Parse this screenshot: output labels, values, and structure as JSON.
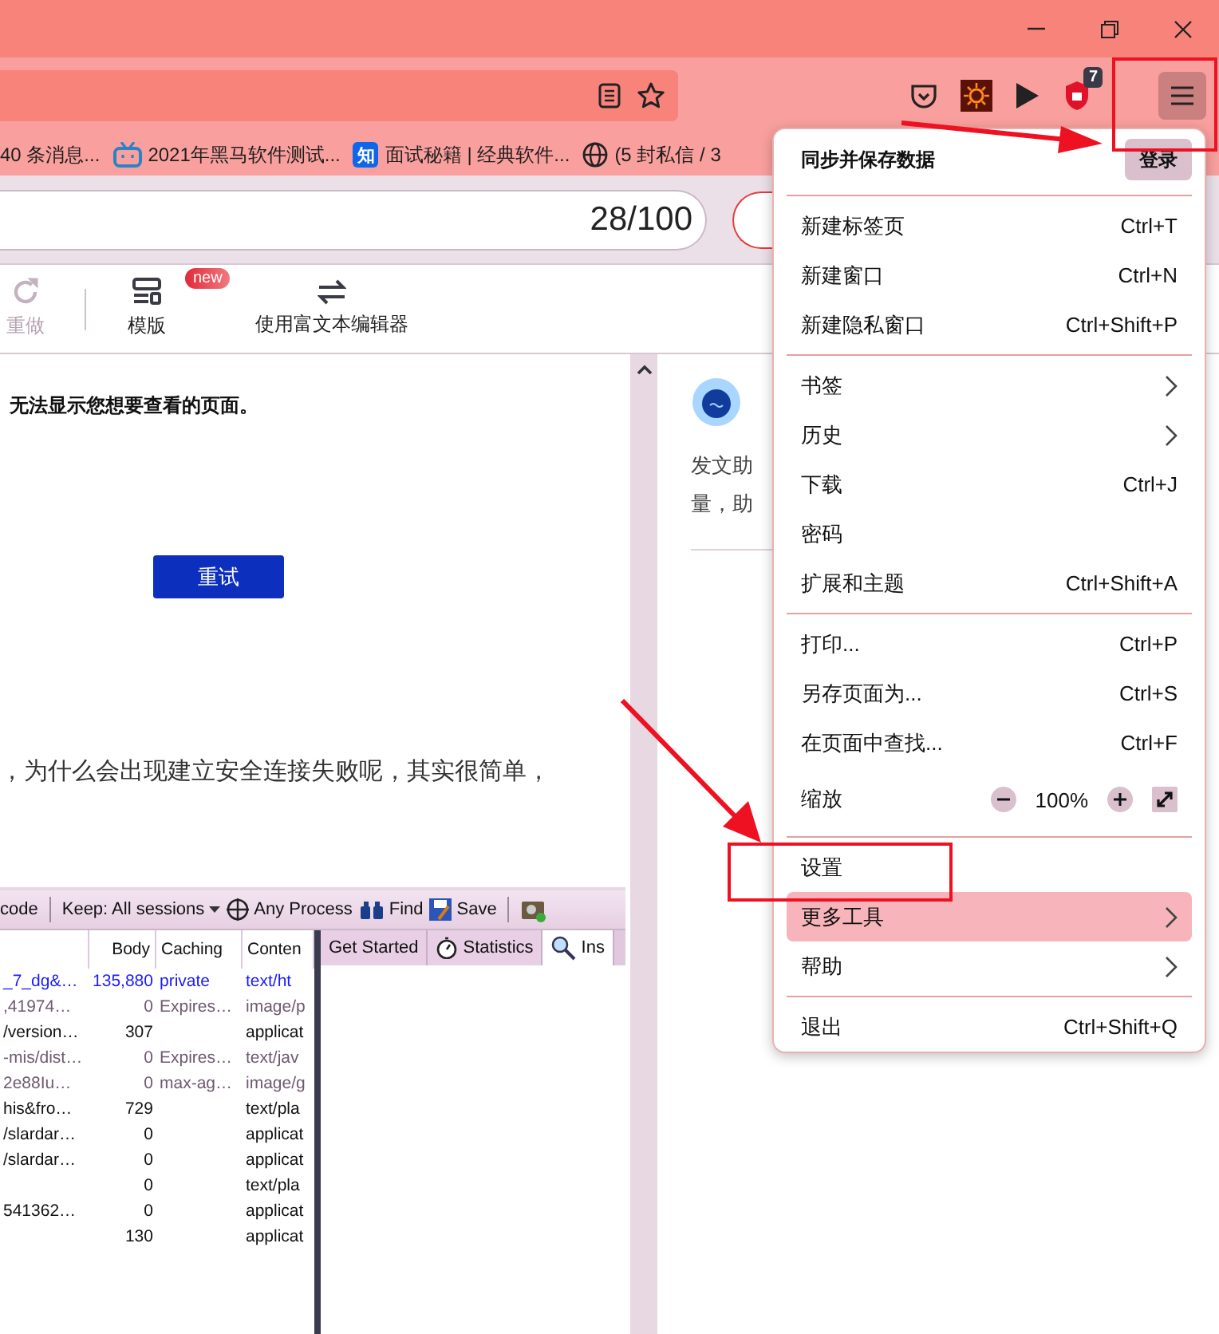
{
  "toolbar": {
    "extension_badge": "7"
  },
  "bookmarks": [
    {
      "label": "40 条消息...",
      "kind": "plain"
    },
    {
      "label": "2021年黑马软件测试...",
      "kind": "video"
    },
    {
      "label": "面试秘籍 | 经典软件...",
      "kind": "lettermark",
      "icon_text": "知"
    },
    {
      "label": "(5 封私信 / 3",
      "kind": "web"
    }
  ],
  "title_field": {
    "counter": "28/100"
  },
  "editor_toolbar": [
    {
      "label": "重做",
      "kind": "redo",
      "disabled": true
    },
    {
      "label": "模版",
      "kind": "template",
      "disabled": false,
      "badge": "new"
    },
    {
      "label": "使用富文本编辑器",
      "kind": "switch",
      "disabled": false
    }
  ],
  "editor": {
    "error_message": "无法显示您想要查看的页面。",
    "retry_button": "重试",
    "paragraph": "，为什么会出现建立安全连接失败呢，其实很简单，"
  },
  "assistant": {
    "text_lines": [
      "发文助",
      "量，助"
    ]
  },
  "fiddler": {
    "toolbar": [
      {
        "label": "code",
        "kind": "text"
      },
      {
        "label": "Keep: All sessions",
        "kind": "dropdown"
      },
      {
        "label": "Any Process",
        "kind": "target"
      },
      {
        "label": "Find",
        "kind": "find"
      },
      {
        "label": "Save",
        "kind": "save"
      }
    ],
    "columns": [
      "Body",
      "Caching",
      "Conten"
    ],
    "rows": [
      {
        "url": "_7_dg&…",
        "body": "135,880",
        "caching": "private",
        "content": "text/ht",
        "color": "#1a1aff"
      },
      {
        "url": ",41974…",
        "body": "0",
        "caching": "Expires…",
        "content": "image/p",
        "color": "#6e5a70"
      },
      {
        "url": "/version…",
        "body": "307",
        "content": "applicat",
        "color": "#111111"
      },
      {
        "url": "-mis/dist…",
        "body": "0",
        "caching": "Expires…",
        "content": "text/jav",
        "color": "#6e5a70"
      },
      {
        "url": "2e88Iu…",
        "body": "0",
        "caching": "max-ag…",
        "content": "image/g",
        "color": "#6e5a70"
      },
      {
        "url": "his&fro…",
        "body": "729",
        "content": "text/pla",
        "color": "#111111"
      },
      {
        "url": "/slardar…",
        "body": "0",
        "content": "applicat",
        "color": "#111111"
      },
      {
        "url": "/slardar…",
        "body": "0",
        "content": "applicat",
        "color": "#111111"
      },
      {
        "body": "0",
        "content": "text/pla",
        "color": "#111111"
      },
      {
        "url": "541362…",
        "body": "0",
        "content": "applicat",
        "color": "#111111"
      },
      {
        "body": "130",
        "content": "applicat",
        "color": "#111111"
      }
    ],
    "tabs": [
      {
        "label": "Get Started",
        "kind": "plain",
        "selected": false
      },
      {
        "label": "Statistics",
        "kind": "timer",
        "selected": false
      },
      {
        "label": "Ins",
        "kind": "inspect",
        "selected": true
      }
    ]
  },
  "menu": {
    "sync": {
      "label": "同步并保存数据",
      "button": "登录"
    },
    "groups": [
      [
        {
          "label": "新建标签页",
          "shortcut": "Ctrl+T",
          "kind": "item",
          "highlighted": false
        },
        {
          "label": "新建窗口",
          "shortcut": "Ctrl+N",
          "kind": "item",
          "highlighted": false
        },
        {
          "label": "新建隐私窗口",
          "shortcut": "Ctrl+Shift+P",
          "kind": "item",
          "highlighted": false
        }
      ],
      [
        {
          "label": "书签",
          "kind": "submenu",
          "highlighted": false
        },
        {
          "label": "历史",
          "kind": "submenu",
          "highlighted": false
        },
        {
          "label": "下载",
          "shortcut": "Ctrl+J",
          "kind": "item",
          "highlighted": false
        },
        {
          "label": "密码",
          "kind": "item",
          "highlighted": false
        },
        {
          "label": "扩展和主题",
          "shortcut": "Ctrl+Shift+A",
          "kind": "item",
          "highlighted": false
        }
      ],
      [
        {
          "label": "打印...",
          "shortcut": "Ctrl+P",
          "kind": "item",
          "highlighted": false
        },
        {
          "label": "另存页面为...",
          "shortcut": "Ctrl+S",
          "kind": "item",
          "highlighted": false
        },
        {
          "label": "在页面中查找...",
          "shortcut": "Ctrl+F",
          "kind": "item",
          "highlighted": false
        },
        {
          "label": "缩放",
          "value": "100%",
          "kind": "zoom",
          "highlighted": false
        }
      ],
      [
        {
          "label": "设置",
          "kind": "item",
          "highlighted": false
        },
        {
          "label": "更多工具",
          "kind": "submenu",
          "highlighted": true
        },
        {
          "label": "帮助",
          "kind": "submenu",
          "highlighted": false
        }
      ],
      [
        {
          "label": "退出",
          "shortcut": "Ctrl+Shift+Q",
          "kind": "item",
          "highlighted": false
        }
      ]
    ]
  }
}
